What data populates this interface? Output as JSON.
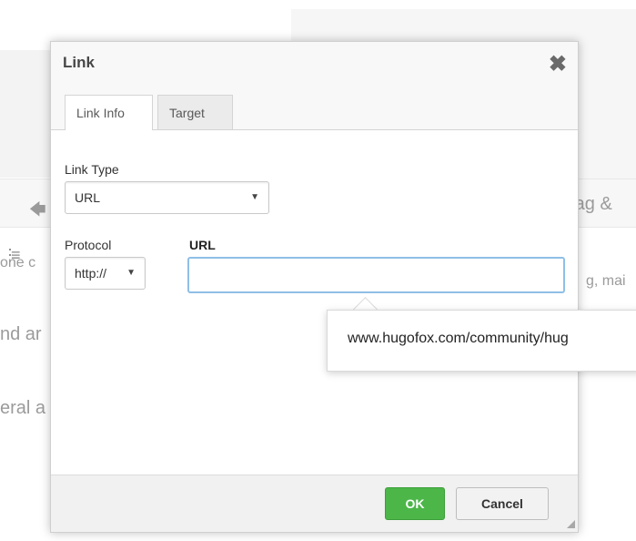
{
  "background": {
    "toolbar_arrow_icon": "arrow-left-icon",
    "format_icons": [
      "list-bullet-icon",
      "align-justify-icon"
    ],
    "snippets": {
      "drag_text": "rag &",
      "line1_left": "one c",
      "line2_left": "nd ar",
      "line3_left": "eral a",
      "line1_right": "g, mai"
    }
  },
  "dialog": {
    "title": "Link",
    "close_icon": "close-icon",
    "tabs": [
      {
        "label": "Link Info",
        "active": true
      },
      {
        "label": "Target",
        "active": false
      }
    ],
    "link_type": {
      "label": "Link Type",
      "value": "URL"
    },
    "protocol": {
      "label": "Protocol",
      "value": "http://"
    },
    "url": {
      "label": "URL",
      "value": "",
      "placeholder": ""
    },
    "buttons": {
      "ok": "OK",
      "cancel": "Cancel"
    }
  },
  "autocomplete": {
    "items": [
      "www.hugofox.com/community/hug"
    ]
  },
  "colors": {
    "ok_button": "#4cb649",
    "url_focus_border": "#8fbfe6"
  }
}
